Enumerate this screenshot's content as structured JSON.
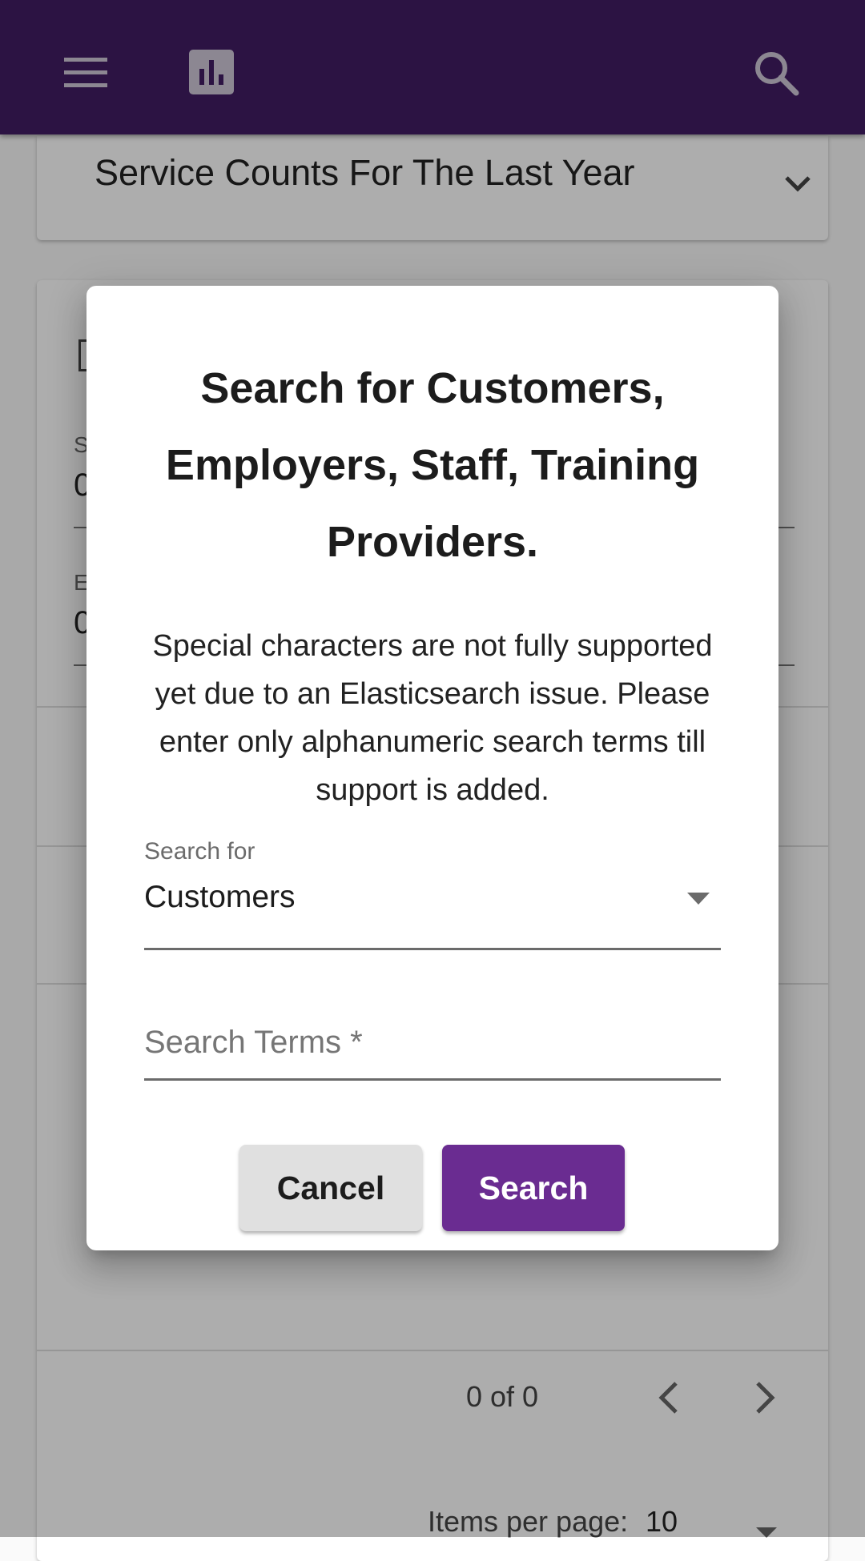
{
  "toolbar": {
    "menu_icon": "menu-icon",
    "chart_icon": "bar-chart-icon",
    "search_icon": "search-icon",
    "background_color": "#421c63"
  },
  "panel": {
    "title": "Service Counts For The Last Year",
    "chevron_icon": "chevron-down-icon"
  },
  "background_form": {
    "start_label": "S",
    "start_value": "0",
    "end_label": "E",
    "end_value": "0"
  },
  "paginator": {
    "range": "0 of 0",
    "items_per_page_label": "Items per page:",
    "items_per_page_value": "10"
  },
  "dialog": {
    "title": "Search for Customers, Employers, Staff, Training Providers.",
    "notice": "Special characters are not fully supported yet due to an Elasticsearch issue. Please enter only alphanumeric search terms till support is added.",
    "search_for": {
      "label": "Search for",
      "value": "Customers"
    },
    "search_terms": {
      "placeholder": "Search Terms *",
      "value": ""
    },
    "cancel_label": "Cancel",
    "search_label": "Search",
    "accent_color": "#6a2c91"
  }
}
